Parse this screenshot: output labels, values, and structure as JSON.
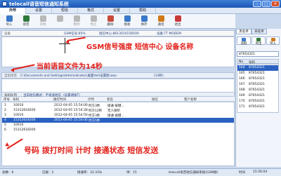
{
  "window": {
    "title": "telecall语音短信通知系统"
  },
  "tabs": [
    "外呼",
    "设置",
    "短信",
    "格式",
    "设置",
    "帮助"
  ],
  "toolbar": [
    {
      "label": "导入",
      "color": "#3a78c8",
      "disabled": false
    },
    {
      "label": "语音",
      "color": "#2f7a3b",
      "disabled": false
    },
    {
      "label": "开始",
      "color": "#b8b8b8",
      "disabled": true
    },
    {
      "label": "",
      "color": "#b8b8b8",
      "disabled": true
    },
    {
      "label": "暂停",
      "color": "#b8b8b8",
      "disabled": true
    },
    {
      "label": "停止",
      "color": "#b8b8b8",
      "disabled": true
    },
    {
      "label": "删除",
      "color": "#c84b3a",
      "disabled": false
    },
    {
      "label": "接收",
      "color": "#3a78c8",
      "disabled": false
    },
    {
      "label": "保存",
      "color": "#3a78c8",
      "disabled": false
    },
    {
      "label": "通话",
      "color": "#d07a1a",
      "disabled": false
    },
    {
      "label": "退出",
      "color": "#c83a3a",
      "disabled": false
    }
  ],
  "device_status": {
    "label": "设备",
    "signal": "GSM信号:85%",
    "sms_center": "短信中心:8613010158500",
    "device_name": "设备:TT MODEM"
  },
  "annotations": {
    "signal": "GSM信号强度 短信中心 设备名称",
    "voice": "当前语音文件为14秒",
    "fields": "号码 拨打时间 计时 接通状态 短信发送"
  },
  "file_bar": {
    "label": "当前语音",
    "path": "C:\\Documents and Settings\\Administrator\\桌面\\tel\\设置图.wav",
    "duration": "(14秒)"
  },
  "list_header": {
    "label": "号码队列",
    "hint": "当前短信模式：不发送短信（设置请按T）"
  },
  "table": {
    "columns": [
      "序号",
      "号码",
      "拨打时间",
      "计时",
      "状态",
      "短信",
      "客户名称"
    ],
    "rows": [
      {
        "no": "1",
        "number": "10010",
        "time": "2012-04-05 15:54:00",
        "duration": "时方3秒",
        "status": "接通 按键...",
        "sms": "",
        "client": ""
      },
      {
        "no": "2",
        "number": "15312618200",
        "time": "2012-04-05 15:54:28",
        "duration": "时方12秒",
        "status": "无人接听",
        "sms": "",
        "client": ""
      },
      {
        "no": "3",
        "number": "10010",
        "time": "2012-04-05 15:54:50",
        "duration": "时方3秒",
        "status": "接通 按键...",
        "sms": "",
        "client": ""
      },
      {
        "no": "4",
        "number": "15312618200",
        "time": "2012-04-05 15:56:00",
        "duration": "时方5秒",
        "status": "",
        "sms": "",
        "client": ""
      },
      {
        "no": "5",
        "number": "10010",
        "time": "",
        "duration": "",
        "status": "",
        "sms": "",
        "client": ""
      },
      {
        "no": "6",
        "number": "15312618200",
        "time": "",
        "duration": "",
        "status": "",
        "sms": "",
        "client": ""
      }
    ]
  },
  "right_panel": {
    "tabs": [
      "黑名单",
      "白名单"
    ],
    "buttons": [
      "读取",
      "导出",
      "导入",
      "删除",
      "全部"
    ],
    "input_value": "87654321",
    "list_header": [
      "No",
      "号码"
    ],
    "rows": [
      {
        "no": "164",
        "number": "87654321"
      },
      {
        "no": "165",
        "number": "87654321"
      },
      {
        "no": "166",
        "number": "87654321"
      },
      {
        "no": "167",
        "number": "87654321"
      },
      {
        "no": "168",
        "number": "87654321"
      },
      {
        "no": "169",
        "number": "87654321"
      },
      {
        "no": "170",
        "number": "87654321"
      },
      {
        "no": "171",
        "number": "87654321"
      }
    ]
  },
  "statusbar": {
    "count_label": "总数：6",
    "done_label": "已拨：2",
    "connected_label": "接通率：33.33%",
    "pending_label": "待：15",
    "app_name": "telecall语音短信通知系统(GSM版)",
    "time_label": "时间",
    "time_value": "15:56:04"
  },
  "colors": {
    "accent": "#2b62c2",
    "annotation": "#e2211b",
    "title_bar": "#1d56b3"
  }
}
